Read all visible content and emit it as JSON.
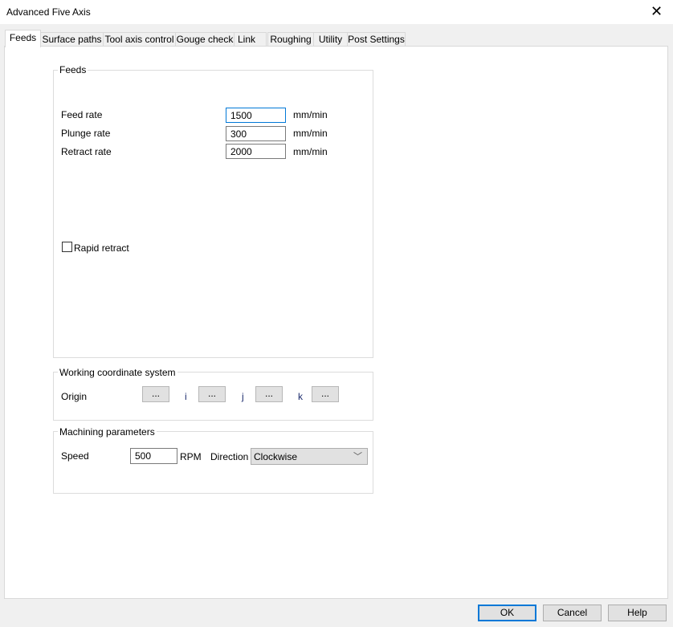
{
  "window": {
    "title": "Advanced Five Axis",
    "close_icon": "close-icon"
  },
  "tabs": [
    "Feeds",
    "Surface paths",
    "Tool axis control",
    "Gouge check",
    "Link",
    "Roughing",
    "Utility",
    "Post Settings"
  ],
  "feeds": {
    "group_label": "Feeds",
    "feed_rate": {
      "label": "Feed rate",
      "value": "1500",
      "unit": "mm/min"
    },
    "plunge_rate": {
      "label": "Plunge rate",
      "value": "300",
      "unit": "mm/min"
    },
    "retract_rate": {
      "label": "Retract rate",
      "value": "2000",
      "unit": "mm/min"
    },
    "rapid_retract": {
      "label": "Rapid retract",
      "checked": false
    }
  },
  "wcs": {
    "group_label": "Working coordinate system",
    "origin_label": "Origin",
    "i_label": "i",
    "j_label": "j",
    "k_label": "k",
    "button_label": "..."
  },
  "machining": {
    "group_label": "Machining parameters",
    "speed_label": "Speed",
    "speed_value": "500",
    "speed_unit": "RPM",
    "direction_label": "Direction",
    "direction_value": "Clockwise"
  },
  "buttons": {
    "ok": "OK",
    "cancel": "Cancel",
    "help": "Help"
  },
  "colors": {
    "ok_border": "#0078d7"
  }
}
